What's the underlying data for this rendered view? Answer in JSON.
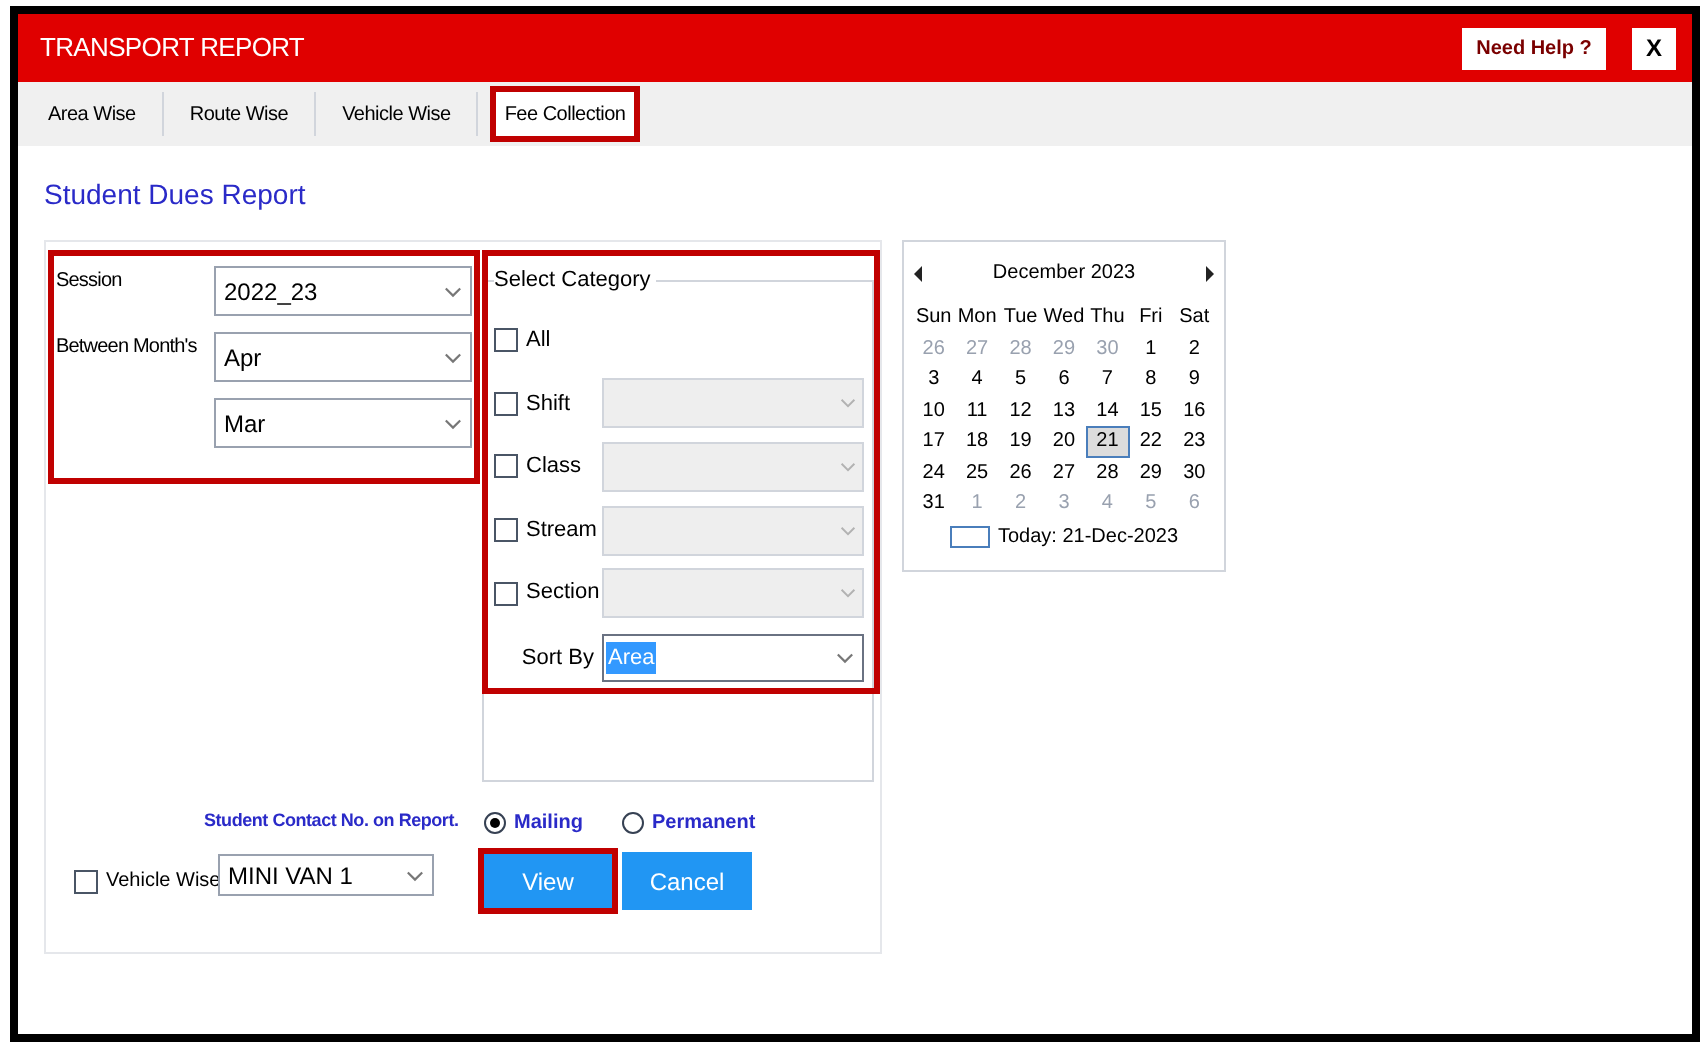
{
  "window": {
    "title": "TRANSPORT REPORT",
    "help_button": "Need Help ?",
    "close_button": "X"
  },
  "tabs": [
    {
      "label": "Area Wise",
      "selected": false,
      "highlighted": false
    },
    {
      "label": "Route Wise",
      "selected": false,
      "highlighted": false
    },
    {
      "label": "Vehicle Wise",
      "selected": false,
      "highlighted": false
    },
    {
      "label": "Fee Collection",
      "selected": true,
      "highlighted": true
    }
  ],
  "heading": "Student Dues Report",
  "period": {
    "highlighted": true,
    "session_label": "Session",
    "session": "2022_23",
    "months_label": "Between Month's",
    "from_month": "Apr",
    "to_month": "Mar"
  },
  "category": {
    "highlighted": true,
    "title": "Select Category",
    "sort_label": "Sort By",
    "sort_value": "Area",
    "options": [
      {
        "label": "All",
        "checked": false,
        "kind": "plain"
      },
      {
        "label": "Shift",
        "checked": false,
        "kind": "dropdown"
      },
      {
        "label": "Class",
        "checked": false,
        "kind": "dropdown"
      },
      {
        "label": "Stream",
        "checked": false,
        "kind": "dropdown"
      },
      {
        "label": "Section",
        "checked": false,
        "kind": "dropdown"
      }
    ]
  },
  "contact": {
    "label": "Student Contact No. on Report.",
    "options": [
      {
        "label": "Mailing",
        "selected": true
      },
      {
        "label": "Permanent",
        "selected": false
      }
    ]
  },
  "vehicle": {
    "label": "Vehicle Wise",
    "checked": false,
    "value": "MINI VAN 1"
  },
  "buttons": [
    {
      "label": "View",
      "highlighted": true
    },
    {
      "label": "Cancel",
      "highlighted": false
    }
  ],
  "calendar": {
    "month": "December 2023",
    "weekdays": [
      "Sun",
      "Mon",
      "Tue",
      "Wed",
      "Thu",
      "Fri",
      "Sat"
    ],
    "today_label": "Today: 21-Dec-2023",
    "weeks": [
      [
        {
          "day": "26",
          "other": true,
          "selected": false
        },
        {
          "day": "27",
          "other": true,
          "selected": false
        },
        {
          "day": "28",
          "other": true,
          "selected": false
        },
        {
          "day": "29",
          "other": true,
          "selected": false
        },
        {
          "day": "30",
          "other": true,
          "selected": false
        },
        {
          "day": "1",
          "other": false,
          "selected": false
        },
        {
          "day": "2",
          "other": false,
          "selected": false
        }
      ],
      [
        {
          "day": "3",
          "other": false,
          "selected": false
        },
        {
          "day": "4",
          "other": false,
          "selected": false
        },
        {
          "day": "5",
          "other": false,
          "selected": false
        },
        {
          "day": "6",
          "other": false,
          "selected": false
        },
        {
          "day": "7",
          "other": false,
          "selected": false
        },
        {
          "day": "8",
          "other": false,
          "selected": false
        },
        {
          "day": "9",
          "other": false,
          "selected": false
        }
      ],
      [
        {
          "day": "10",
          "other": false,
          "selected": false
        },
        {
          "day": "11",
          "other": false,
          "selected": false
        },
        {
          "day": "12",
          "other": false,
          "selected": false
        },
        {
          "day": "13",
          "other": false,
          "selected": false
        },
        {
          "day": "14",
          "other": false,
          "selected": false
        },
        {
          "day": "15",
          "other": false,
          "selected": false
        },
        {
          "day": "16",
          "other": false,
          "selected": false
        }
      ],
      [
        {
          "day": "17",
          "other": false,
          "selected": false
        },
        {
          "day": "18",
          "other": false,
          "selected": false
        },
        {
          "day": "19",
          "other": false,
          "selected": false
        },
        {
          "day": "20",
          "other": false,
          "selected": false
        },
        {
          "day": "21",
          "other": false,
          "selected": true
        },
        {
          "day": "22",
          "other": false,
          "selected": false
        },
        {
          "day": "23",
          "other": false,
          "selected": false
        }
      ],
      [
        {
          "day": "24",
          "other": false,
          "selected": false
        },
        {
          "day": "25",
          "other": false,
          "selected": false
        },
        {
          "day": "26",
          "other": false,
          "selected": false
        },
        {
          "day": "27",
          "other": false,
          "selected": false
        },
        {
          "day": "28",
          "other": false,
          "selected": false
        },
        {
          "day": "29",
          "other": false,
          "selected": false
        },
        {
          "day": "30",
          "other": false,
          "selected": false
        }
      ],
      [
        {
          "day": "31",
          "other": false,
          "selected": false
        },
        {
          "day": "1",
          "other": true,
          "selected": false
        },
        {
          "day": "2",
          "other": true,
          "selected": false
        },
        {
          "day": "3",
          "other": true,
          "selected": false
        },
        {
          "day": "4",
          "other": true,
          "selected": false
        },
        {
          "day": "5",
          "other": true,
          "selected": false
        },
        {
          "day": "6",
          "other": true,
          "selected": false
        }
      ]
    ]
  }
}
